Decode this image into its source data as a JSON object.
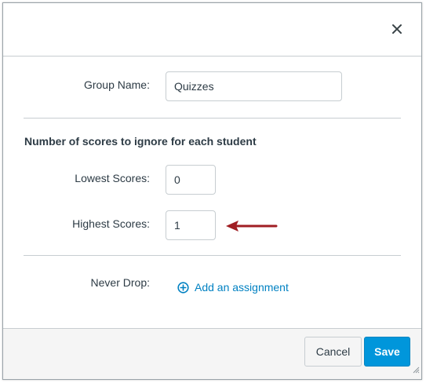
{
  "dialog": {
    "close_icon": "close-icon"
  },
  "group_name": {
    "label": "Group Name:",
    "value": "Quizzes"
  },
  "drop_rules": {
    "section_title": "Number of scores to ignore for each student",
    "lowest": {
      "label": "Lowest Scores:",
      "value": "0"
    },
    "highest": {
      "label": "Highest Scores:",
      "value": "1"
    }
  },
  "never_drop": {
    "label": "Never Drop:",
    "add_link": "Add an assignment",
    "add_icon": "plus-circle-icon"
  },
  "annotation": {
    "arrow_icon": "arrow-left-icon",
    "arrow_color": "#a01e23"
  },
  "footer": {
    "cancel_label": "Cancel",
    "save_label": "Save"
  },
  "colors": {
    "link": "#0081c2",
    "primary_button": "#0096db",
    "text": "#2d3b45"
  }
}
